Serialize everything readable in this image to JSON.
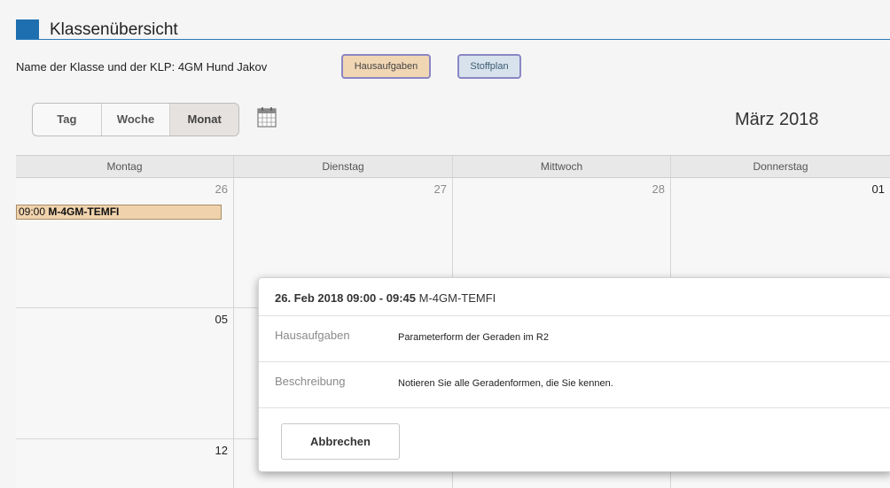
{
  "page": {
    "title": "Klassenübersicht"
  },
  "class_info": {
    "text": "Name der Klasse und der KLP: 4GM Hund Jakov"
  },
  "buttons": {
    "hausaufgaben": "Hausaufgaben",
    "stoffplan": "Stoffplan"
  },
  "view_switch": {
    "day": "Tag",
    "week": "Woche",
    "month": "Monat",
    "active": "Monat"
  },
  "calendar": {
    "month_label": "März 2018",
    "weekdays": [
      "Montag",
      "Dienstag",
      "Mittwoch",
      "Donnerstag"
    ],
    "rows": [
      [
        "26",
        "27",
        "28",
        "01"
      ],
      [
        "05",
        "",
        "",
        ""
      ],
      [
        "12",
        "",
        "",
        ""
      ]
    ],
    "event": {
      "time": "09:00",
      "name": "M-4GM-TEMFI"
    }
  },
  "popup": {
    "header_time": "26. Feb 2018 09:00 - 09:45",
    "header_name": "M-4GM-TEMFI",
    "fields": [
      {
        "label": "Hausaufgaben",
        "value": "Parameterform der Geraden im R2"
      },
      {
        "label": "Beschreibung",
        "value": "Notieren Sie alle Geradenformen, die Sie kennen."
      }
    ],
    "cancel_label": "Abbrechen"
  },
  "colors": {
    "accent": "#1e6fb0",
    "event_fill": "#f0d3ad",
    "hausaufgaben_fill": "#f1d6b4",
    "stoffplan_fill": "#d7e2ec"
  },
  "icons": {
    "calendar_picker": "calendar-icon"
  }
}
